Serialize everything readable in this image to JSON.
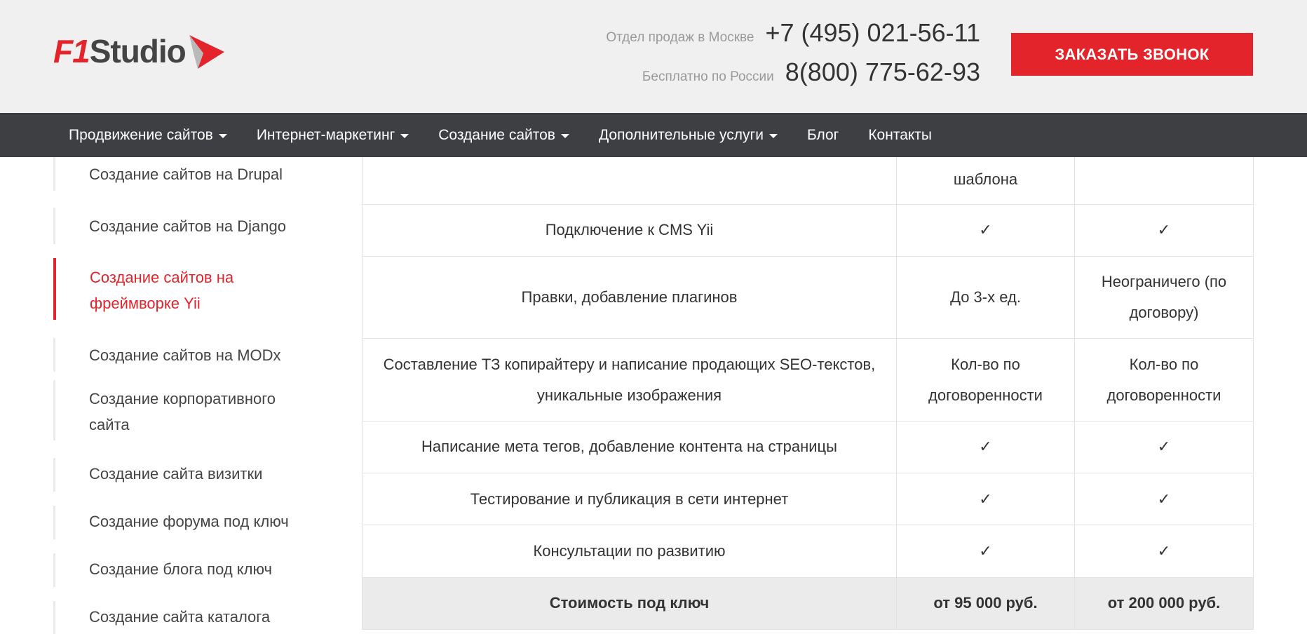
{
  "header": {
    "logo": {
      "part1": "F1",
      "part2": "Studio"
    },
    "contacts": [
      {
        "label": "Отдел продаж в Москве",
        "phone": "+7 (495) 021-56-11"
      },
      {
        "label": "Бесплатно по России",
        "phone": "8(800) 775-62-93"
      }
    ],
    "call_button": "ЗАКАЗАТЬ ЗВОНОК"
  },
  "nav": {
    "items": [
      {
        "label": "Продвижение сайтов"
      },
      {
        "label": "Интернет-маркетинг"
      },
      {
        "label": "Создание сайтов"
      },
      {
        "label": "Дополнительные услуги"
      },
      {
        "label": "Блог"
      },
      {
        "label": "Контакты"
      }
    ]
  },
  "sidebar": {
    "items": [
      {
        "label": "Создание сайтов на Drupal"
      },
      {
        "label": "Создание сайтов на Django"
      },
      {
        "label": "Создание сайтов на фреймворке Yii"
      },
      {
        "label": "Создание сайтов на MODx"
      },
      {
        "label": "Создание корпоративного сайта"
      },
      {
        "label": "Создание сайта визитки"
      },
      {
        "label": "Создание форума под ключ"
      },
      {
        "label": "Создание блога под ключ"
      },
      {
        "label": "Создание сайта каталога"
      }
    ]
  },
  "table": {
    "rows": [
      {
        "feature": "",
        "col1": "шаблона",
        "col2": ""
      },
      {
        "feature": "Подключение к CMS Yii",
        "col1": "✓",
        "col2": "✓"
      },
      {
        "feature": "Правки, добавление плагинов",
        "col1": "До 3-х ед.",
        "col2": "Неограничего (по договору)"
      },
      {
        "feature": "Составление ТЗ копирайтеру и написание продающих SEO-текстов, уникальные изображения",
        "col1": "Кол-во по договоренности",
        "col2": "Кол-во по договоренности"
      },
      {
        "feature": "Написание мета тегов, добавление контента на страницы",
        "col1": "✓",
        "col2": "✓"
      },
      {
        "feature": "Тестирование и публикация в сети интернет",
        "col1": "✓",
        "col2": "✓"
      },
      {
        "feature": "Консультации по развитию",
        "col1": "✓",
        "col2": "✓"
      }
    ],
    "total": {
      "label": "Стоимость под ключ",
      "col1": "от 95 000 руб.",
      "col2": "от 200 000 руб."
    }
  },
  "colors": {
    "accent": "#e3242b",
    "nav_bg": "#3d3f42",
    "header_bg": "#f0f0f0",
    "check": "#1ec31e"
  }
}
